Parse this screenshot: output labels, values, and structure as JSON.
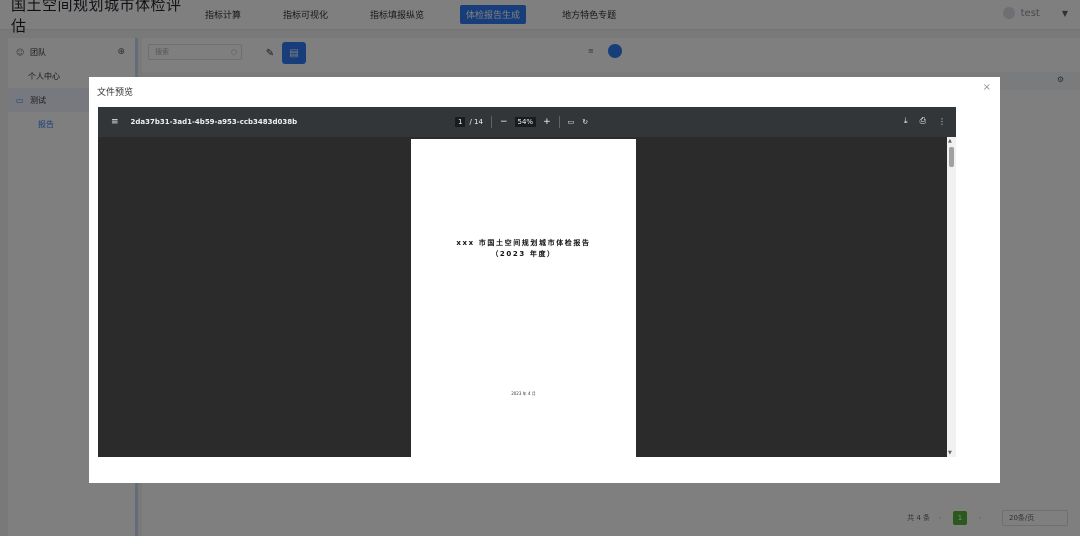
{
  "app": {
    "title": "国土空间规划城市体检评估"
  },
  "nav": {
    "items": [
      {
        "label": "指标计算",
        "active": false
      },
      {
        "label": "指标可视化",
        "active": false
      },
      {
        "label": "指标填报纵览",
        "active": false
      },
      {
        "label": "体检报告生成",
        "active": true
      },
      {
        "label": "地方特色专题",
        "active": false
      }
    ]
  },
  "user": {
    "name": "test"
  },
  "sidebar": {
    "team_label": "团队",
    "personal_label": "个人中心",
    "folder_label": "测试",
    "leaf_label": "报告"
  },
  "main": {
    "search_placeholder": "搜索",
    "pager": {
      "total": "共 4 条",
      "current_page": "1",
      "page_size": "20条/页"
    }
  },
  "dialog": {
    "title": "文件预览",
    "viewer": {
      "file_name": "2da37b31-3ad1-4b59-a953-ccb3483d038b",
      "current_page": "1",
      "total_pages": "/ 14",
      "zoom": "54%",
      "doc_title_line1": "xxx 市国土空间规划城市体检报告",
      "doc_title_line2": "（2023 年度）",
      "doc_date": "2023 年 4 月"
    }
  },
  "colors": {
    "accent": "#2f7cf6",
    "pager_active": "#59b03c",
    "viewer_bg": "#2b2b2b",
    "viewer_toolbar": "#323639"
  }
}
